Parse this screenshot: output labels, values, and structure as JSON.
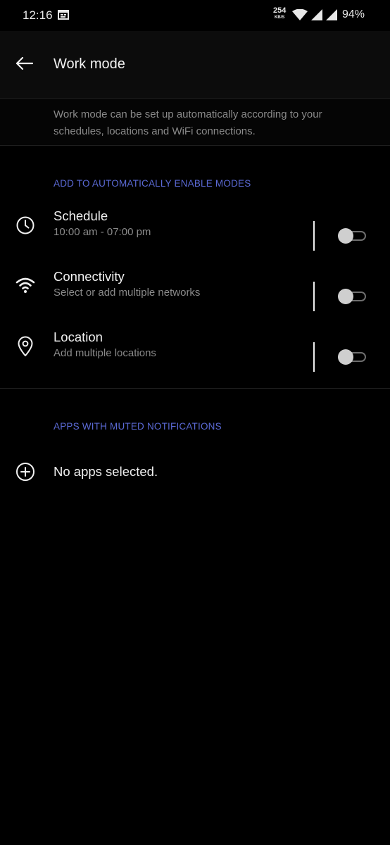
{
  "status_bar": {
    "time": "12:16",
    "net_speed": "254",
    "net_speed_unit": "KB/S",
    "battery": "94%",
    "icons": [
      "notification-icon",
      "wifi-icon",
      "signal-icon",
      "signal-icon"
    ]
  },
  "app_bar": {
    "title": "Work mode",
    "back_icon": "arrow-back-icon"
  },
  "description": "Work mode can be set up automatically according to your schedules, locations and WiFi connections.",
  "sections": {
    "auto_modes": {
      "header": "ADD TO AUTOMATICALLY ENABLE MODES",
      "items": [
        {
          "title": "Schedule",
          "subtitle": "10:00 am - 07:00 pm",
          "icon": "clock-icon",
          "enabled": false
        },
        {
          "title": "Connectivity",
          "subtitle": "Select or add multiple networks",
          "icon": "wifi-icon",
          "enabled": false
        },
        {
          "title": "Location",
          "subtitle": "Add multiple locations",
          "icon": "location-pin-icon",
          "enabled": false
        }
      ]
    },
    "muted_apps": {
      "header": "APPS WITH MUTED NOTIFICATIONS",
      "empty_label": "No apps selected.",
      "icon": "add-circle-icon"
    }
  },
  "colors": {
    "background": "#000000",
    "accent": "#5b6ad6",
    "primary_text": "#f0f0f0",
    "secondary_text": "#8a8a8a"
  }
}
